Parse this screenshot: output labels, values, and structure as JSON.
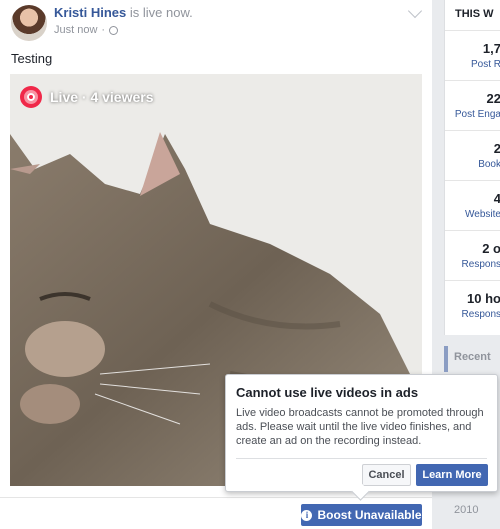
{
  "post": {
    "author_name": "Kristi Hines",
    "status": " is live now.",
    "timestamp": "Just now",
    "separator": "·",
    "text": "Testing",
    "live_label": "Live · 4 viewers",
    "boost_label": "Boost Unavailable"
  },
  "popover": {
    "title": "Cannot use live videos in ads",
    "body": "Live video broadcasts cannot be promoted through ads. Please wait until the live video finishes, and create an ad on the recording instead.",
    "cancel_label": "Cancel",
    "learn_more_label": "Learn More"
  },
  "sidebar": {
    "header": "THIS W",
    "rows": [
      {
        "value": "1,7",
        "label": "Post R"
      },
      {
        "value": "22",
        "label": "Post Enga"
      },
      {
        "value": "2",
        "label": "Book"
      },
      {
        "value": "4",
        "label": "Website"
      },
      {
        "value": "2 o",
        "label": "Respons"
      },
      {
        "value": "10 ho",
        "label": "Respons"
      }
    ]
  },
  "timeline": {
    "recent": "Recent",
    "year": "2010"
  },
  "colors": {
    "facebook_blue": "#4267b2",
    "live_red": "#f02849",
    "link_blue": "#365899"
  }
}
